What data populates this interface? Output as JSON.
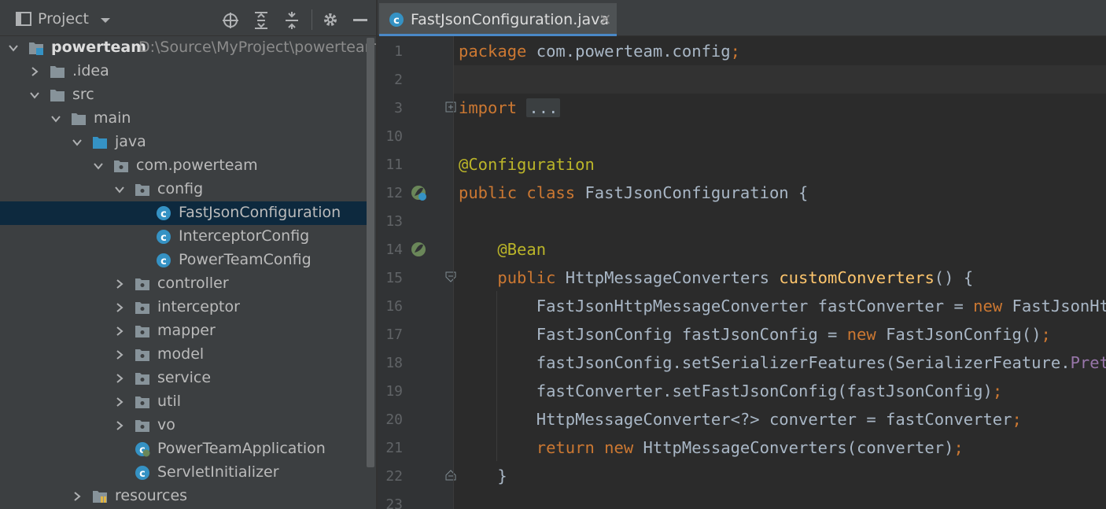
{
  "project_panel": {
    "title": "Project",
    "toolbar_icons": [
      "dropdown-icon",
      "locate-icon",
      "expand-all-icon",
      "collapse-all-icon",
      "gear-icon",
      "minimize-icon"
    ],
    "tree": [
      {
        "label": "powerteam",
        "path": "D:\\Source\\MyProject\\powerteam",
        "type": "project",
        "expanded": true
      },
      {
        "label": ".idea",
        "type": "folder",
        "expanded": false
      },
      {
        "label": "src",
        "type": "folder",
        "expanded": true
      },
      {
        "label": "main",
        "type": "folder",
        "expanded": true
      },
      {
        "label": "java",
        "type": "source-folder",
        "expanded": true
      },
      {
        "label": "com.powerteam",
        "type": "package",
        "expanded": true
      },
      {
        "label": "config",
        "type": "package",
        "expanded": true
      },
      {
        "label": "FastJsonConfiguration",
        "type": "class",
        "selected": true
      },
      {
        "label": "InterceptorConfig",
        "type": "class"
      },
      {
        "label": "PowerTeamConfig",
        "type": "class"
      },
      {
        "label": "controller",
        "type": "package",
        "expanded": false
      },
      {
        "label": "interceptor",
        "type": "package",
        "expanded": false
      },
      {
        "label": "mapper",
        "type": "package",
        "expanded": false
      },
      {
        "label": "model",
        "type": "package",
        "expanded": false
      },
      {
        "label": "service",
        "type": "package",
        "expanded": false
      },
      {
        "label": "util",
        "type": "package",
        "expanded": false
      },
      {
        "label": "vo",
        "type": "package",
        "expanded": false
      },
      {
        "label": "PowerTeamApplication",
        "type": "spring-class"
      },
      {
        "label": "ServletInitializer",
        "type": "class"
      },
      {
        "label": "resources",
        "type": "resources-folder",
        "expanded": false
      }
    ]
  },
  "editor": {
    "tab": {
      "label": "FastJsonConfiguration.java",
      "close": "×"
    },
    "line_numbers": [
      "1",
      "2",
      "3",
      "10",
      "11",
      "12",
      "13",
      "14",
      "15",
      "16",
      "17",
      "18",
      "19",
      "20",
      "21",
      "22",
      "23"
    ],
    "code_lines": [
      [
        {
          "t": "package ",
          "c": "kw"
        },
        {
          "t": "com.powerteam.config"
        },
        {
          "t": ";",
          "c": "kw"
        }
      ],
      [],
      [
        {
          "t": "import ",
          "c": "kw"
        },
        {
          "t": "...",
          "c": "fold"
        }
      ],
      [],
      [
        {
          "t": "@Configuration",
          "c": "ann"
        }
      ],
      [
        {
          "t": "public class ",
          "c": "kw"
        },
        {
          "t": "FastJsonConfiguration {"
        }
      ],
      [],
      [
        {
          "t": "    "
        },
        {
          "t": "@Bean",
          "c": "ann"
        }
      ],
      [
        {
          "t": "    "
        },
        {
          "t": "public ",
          "c": "kw"
        },
        {
          "t": "HttpMessageConverters "
        },
        {
          "t": "customConverters",
          "c": "fn"
        },
        {
          "t": "() {"
        }
      ],
      [
        {
          "t": "        FastJsonHttpMessageConverter fastConverter = "
        },
        {
          "t": "new ",
          "c": "kw"
        },
        {
          "t": "FastJsonHttpMessageConverter()"
        },
        {
          "t": ";",
          "c": "kw"
        }
      ],
      [
        {
          "t": "        FastJsonConfig fastJsonConfig = "
        },
        {
          "t": "new ",
          "c": "kw"
        },
        {
          "t": "FastJsonConfig()"
        },
        {
          "t": ";",
          "c": "kw"
        }
      ],
      [
        {
          "t": "        fastJsonConfig.setSerializerFeatures(SerializerFeature."
        },
        {
          "t": "PrettyFormat",
          "c": "clip"
        },
        {
          "t": ");"
        }
      ],
      [
        {
          "t": "        fastConverter.setFastJsonConfig(fastJsonConfig)"
        },
        {
          "t": ";",
          "c": "kw"
        }
      ],
      [
        {
          "t": "        HttpMessageConverter<?> converter = fastConverter"
        },
        {
          "t": ";",
          "c": "kw"
        }
      ],
      [
        {
          "t": "        "
        },
        {
          "t": "return new ",
          "c": "kw"
        },
        {
          "t": "HttpMessageConverters(converter)"
        },
        {
          "t": ";",
          "c": "kw"
        }
      ],
      [
        {
          "t": "    }"
        }
      ],
      []
    ],
    "gutter_icons": {
      "line_12": "spring-config-icon",
      "line_14": "spring-bean-icon"
    },
    "colors": {
      "keyword": "#cc7832",
      "annotation": "#bbb529",
      "method": "#ffc66d",
      "plain": "#a9b7c6",
      "selection": "#0d293e",
      "tab_underline": "#4a88c7"
    }
  }
}
